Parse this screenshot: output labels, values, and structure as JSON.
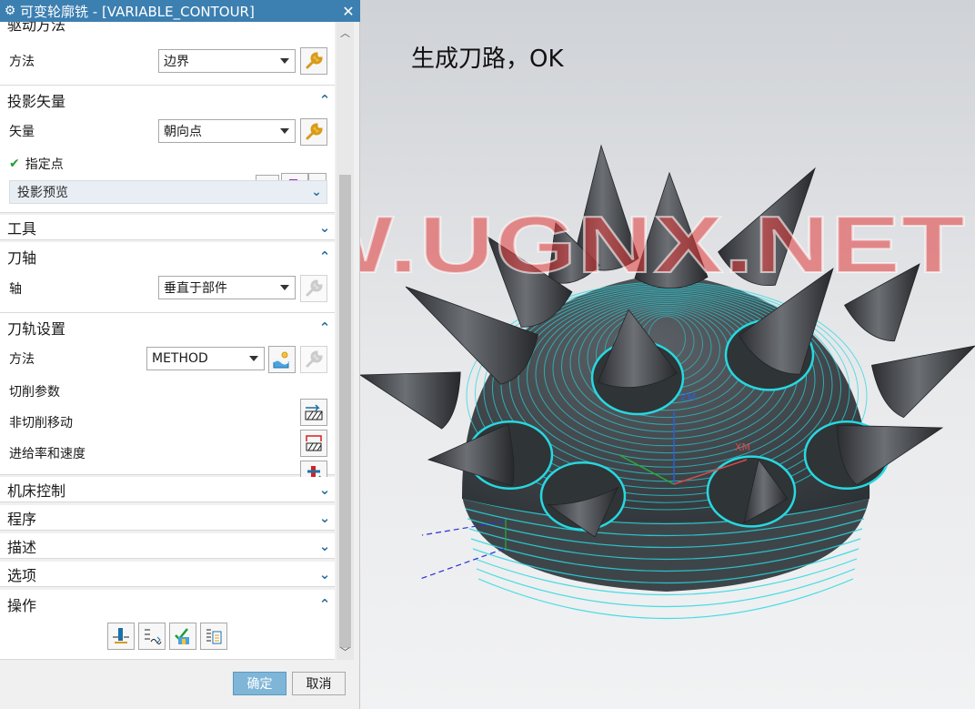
{
  "dialog": {
    "title": "可变轮廓铣 - [VARIABLE_CONTOUR]",
    "drive_method": {
      "title_partial": "驱动方法",
      "method_label": "方法",
      "method_value": "边界"
    },
    "projection_vector": {
      "title": "投影矢量",
      "vector_label": "矢量",
      "vector_value": "朝向点",
      "specify_point_label": "指定点",
      "preview_label": "投影预览"
    },
    "tool": {
      "title": "工具"
    },
    "tool_axis": {
      "title": "刀轴",
      "axis_label": "轴",
      "axis_value": "垂直于部件"
    },
    "path_settings": {
      "title": "刀轨设置",
      "method_label": "方法",
      "method_value": "METHOD",
      "cut_params_label": "切削参数",
      "non_cut_moves_label": "非切削移动",
      "feeds_speeds_label": "进给率和速度"
    },
    "collapsed_groups": [
      "机床控制",
      "程序",
      "描述",
      "选项"
    ],
    "actions": {
      "title": "操作"
    },
    "ok_label": "确定",
    "cancel_label": "取消"
  },
  "viewport": {
    "message": "生成刀路，OK",
    "watermark": "WWW.UGNX.NET",
    "axis_labels": {
      "z": "ZM",
      "x": "XM"
    }
  },
  "colors": {
    "titlebar": "#3c7fb1",
    "accent_chevron": "#2b6f9c",
    "toolpath": "#27d8e0",
    "spike": "#3d3f43",
    "ok_button": "#7fb6d8"
  }
}
